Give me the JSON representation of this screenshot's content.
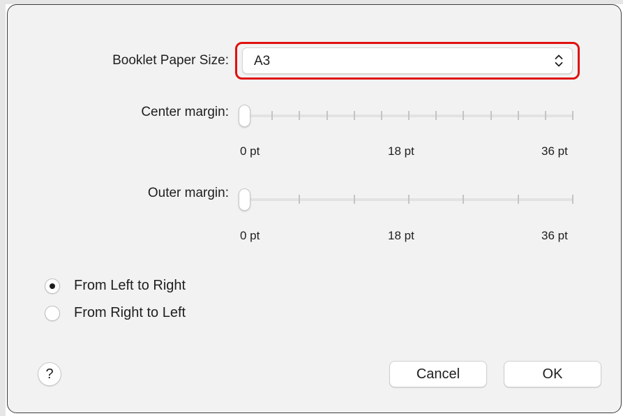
{
  "booklet_paper_size": {
    "label": "Booklet Paper Size:",
    "selected": "A3"
  },
  "center_margin": {
    "label": "Center margin:",
    "value": 0,
    "min": 0,
    "max": 36,
    "unit": "pt",
    "tick_count": 13,
    "tick_labels": [
      "0 pt",
      "18 pt",
      "36 pt"
    ]
  },
  "outer_margin": {
    "label": "Outer margin:",
    "value": 0,
    "min": 0,
    "max": 36,
    "unit": "pt",
    "tick_count": 7,
    "tick_labels": [
      "0 pt",
      "18 pt",
      "36 pt"
    ]
  },
  "direction": {
    "options": [
      {
        "label": "From Left to Right",
        "selected": true
      },
      {
        "label": "From Right to Left",
        "selected": false
      }
    ]
  },
  "help": {
    "label": "?"
  },
  "buttons": {
    "cancel": "Cancel",
    "ok": "OK"
  },
  "colors": {
    "highlight": "#e01010",
    "dialog_background": "#f2f2f2"
  },
  "icons": {
    "popup": "up-down-chevron-icon"
  }
}
